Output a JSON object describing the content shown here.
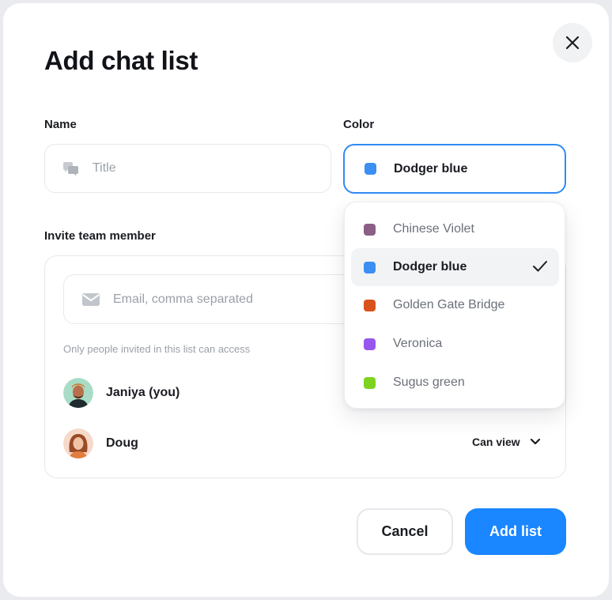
{
  "dialog": {
    "title": "Add chat list",
    "close_icon": "close-icon"
  },
  "name_field": {
    "label": "Name",
    "placeholder": "Title",
    "icon": "chat-bubbles-icon"
  },
  "color_field": {
    "label": "Color",
    "value": "Dodger blue",
    "value_color": "#3b8ff3"
  },
  "color_options": [
    {
      "label": "Chinese Violet",
      "color": "#8b5f86",
      "selected": false
    },
    {
      "label": "Dodger blue",
      "color": "#3b8ff3",
      "selected": true
    },
    {
      "label": "Golden Gate Bridge",
      "color": "#d8521b",
      "selected": false
    },
    {
      "label": "Veronica",
      "color": "#9757ee",
      "selected": false
    },
    {
      "label": "Sugus green",
      "color": "#7ed321",
      "selected": false
    }
  ],
  "invite": {
    "label": "Invite team member",
    "email_placeholder": "Email, comma separated",
    "email_icon": "envelope-icon",
    "hint": "Only people invited in this list can access",
    "members": [
      {
        "name": "Janiya (you)"
      },
      {
        "name": "Doug",
        "permission": "Can view"
      }
    ]
  },
  "actions": {
    "cancel_label": "Cancel",
    "submit_label": "Add list"
  },
  "colors": {
    "accent": "#1a86ff",
    "focus_border": "#2f8bf5"
  }
}
